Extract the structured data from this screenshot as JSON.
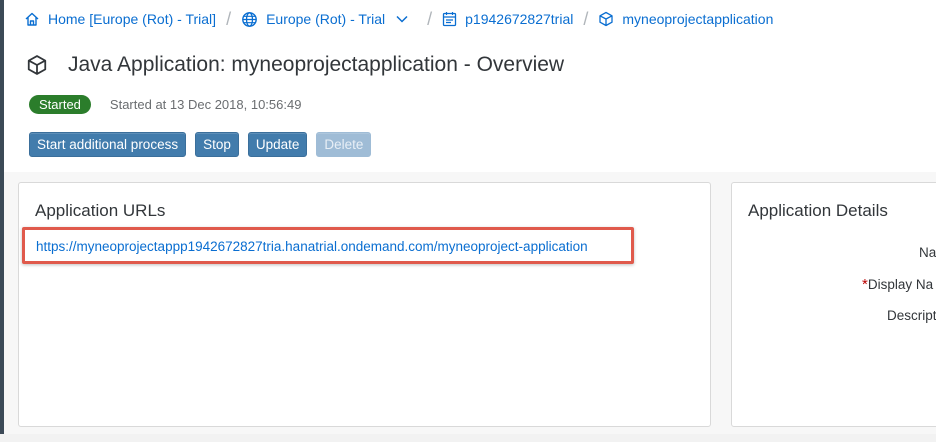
{
  "breadcrumb": {
    "home": "Home [Europe (Rot) - Trial]",
    "region": "Europe (Rot) - Trial",
    "account": "p1942672827trial",
    "application": "myneoprojectapplication",
    "separator": "/"
  },
  "header": {
    "title": "Java Application: myneoprojectapplication - Overview",
    "status_badge": "Started",
    "status_text": "Started at 13 Dec 2018, 10:56:49"
  },
  "toolbar": {
    "start_label": "Start additional process",
    "stop_label": "Stop",
    "update_label": "Update",
    "delete_label": "Delete"
  },
  "urls_panel": {
    "title": "Application URLs",
    "url": "https://myneoprojectappp1942672827tria.hanatrial.ondemand.com/myneoproject-application"
  },
  "details_panel": {
    "title": "Application Details",
    "name_label": "Na",
    "required_marker": "*",
    "display_name_label": "Display Na",
    "description_label": "Descript"
  },
  "colors": {
    "link": "#0a6ed1",
    "button": "#427cac",
    "status_success": "#2b7d2b",
    "highlight": "#e05a4c"
  }
}
